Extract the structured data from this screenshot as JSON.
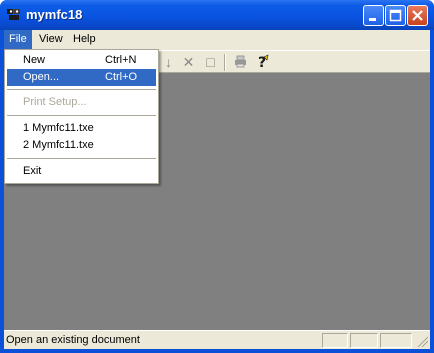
{
  "window": {
    "title": "mymfc18",
    "minimize_icon": "minimize-icon",
    "maximize_icon": "maximize-icon",
    "close_icon": "close-icon"
  },
  "menubar": {
    "items": [
      {
        "label": "File"
      },
      {
        "label": "View"
      },
      {
        "label": "Help"
      }
    ]
  },
  "file_menu": {
    "new": {
      "label": "New",
      "accel": "Ctrl+N"
    },
    "open": {
      "label": "Open...",
      "accel": "Ctrl+O"
    },
    "print_setup": {
      "label": "Print Setup..."
    },
    "recent1": {
      "label": "1 Mymfc11.txe"
    },
    "recent2": {
      "label": "2 Mymfc11.txe"
    },
    "exit": {
      "label": "Exit"
    }
  },
  "toolbar": {
    "icons": [
      "new-icon",
      "open-icon",
      "save-icon",
      "cut-icon",
      "copy-icon",
      "paste-icon",
      "print-icon",
      "help-icon"
    ]
  },
  "statusbar": {
    "text": "Open an existing document"
  },
  "colors": {
    "titlebar": "#0a50d8",
    "menu_highlight": "#316ac5",
    "workspace": "#808080",
    "chrome": "#ece9d8"
  }
}
